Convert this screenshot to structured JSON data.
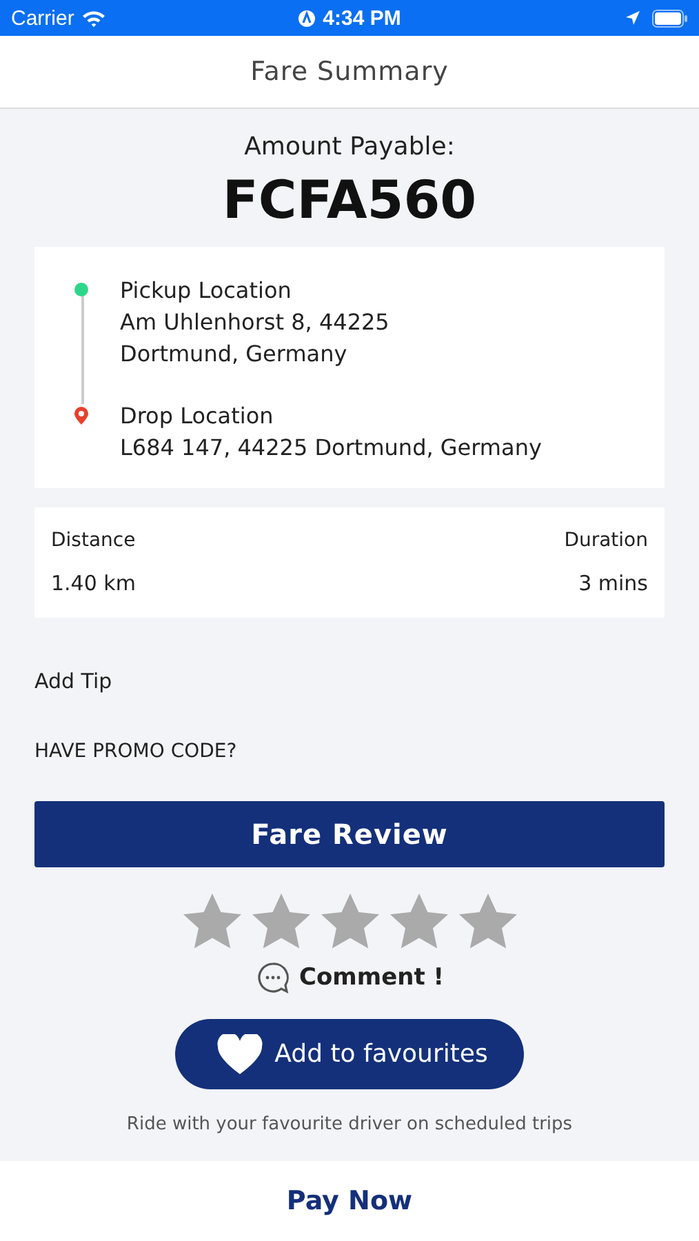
{
  "status_bar": {
    "carrier": "Carrier",
    "time": "4:34 PM"
  },
  "header": {
    "title": "Fare Summary"
  },
  "amount": {
    "label": "Amount Payable:",
    "value": "FCFA560"
  },
  "route": [
    {
      "kind": "pickup",
      "label": "Pickup Location",
      "address": "Am Uhlenhorst 8, 44225\nDortmund, Germany",
      "color": "#2ed68a"
    },
    {
      "kind": "drop",
      "label": "Drop Location",
      "address": "L684 147, 44225 Dortmund, Germany",
      "color": "#e8402c"
    }
  ],
  "trip": {
    "distance_label": "Distance",
    "distance": "1.40 km",
    "duration_label": "Duration",
    "duration": "3 mins"
  },
  "add_tip": "Add Tip",
  "promo": "HAVE PROMO CODE?",
  "review_button": "Fare Review",
  "rating": {
    "stars": 0
  },
  "comment": "Comment !",
  "favourite_button": "Add to favourites",
  "favourite_note": "Ride with your favourite driver on scheduled trips",
  "pay_button": "Pay Now"
}
